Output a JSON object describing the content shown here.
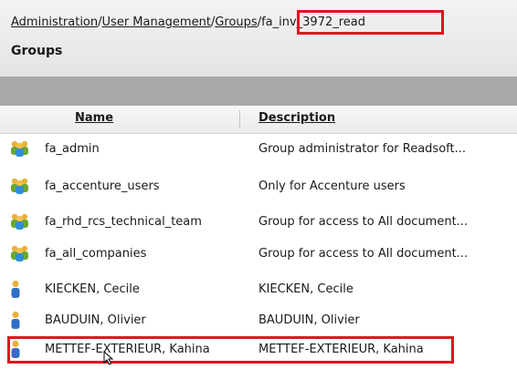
{
  "breadcrumb": {
    "items": [
      "Administration",
      "User Management",
      "Groups"
    ],
    "separator": "/",
    "current": "fa_inv_3972_read"
  },
  "page": {
    "title": "Groups"
  },
  "table": {
    "columns": {
      "name": "Name",
      "description": "Description"
    },
    "rows": [
      {
        "type": "group",
        "icon": "group-icon",
        "name": "fa_admin",
        "description": "Group administrator for Readsoft..."
      },
      {
        "type": "group",
        "icon": "group-icon",
        "name": "fa_accenture_users",
        "description": "Only for Accenture users"
      },
      {
        "type": "group",
        "icon": "group-icon",
        "name": "fa_rhd_rcs_technical_team",
        "description": "Group for access to All document..."
      },
      {
        "type": "group",
        "icon": "group-icon",
        "name": "fa_all_companies",
        "description": "Group for access to All document..."
      },
      {
        "type": "user",
        "icon": "user-icon",
        "name": "KIECKEN, Cecile",
        "description": "KIECKEN, Cecile"
      },
      {
        "type": "user",
        "icon": "user-icon",
        "name": "BAUDUIN, Olivier",
        "description": "BAUDUIN, Olivier"
      },
      {
        "type": "user",
        "icon": "user-icon",
        "name": "METTEF-EXTERIEUR, Kahina",
        "description": "METTEF-EXTERIEUR, Kahina"
      }
    ]
  },
  "colors": {
    "highlight": "#e0141e",
    "band": "#a9a9a9",
    "header_bg": "#e9e9e9"
  }
}
